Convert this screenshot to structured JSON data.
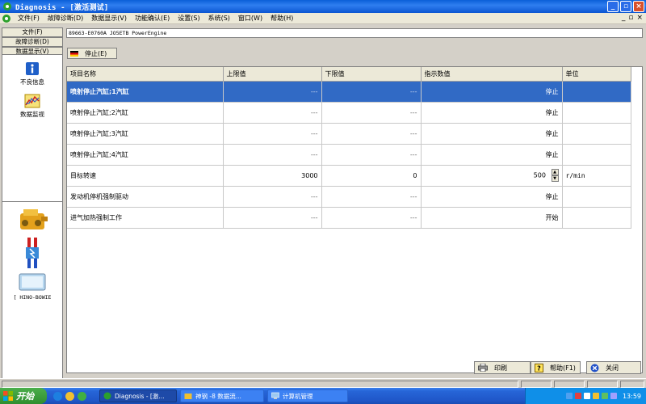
{
  "window": {
    "title": "Diagnosis - [激活测试]"
  },
  "menu": [
    {
      "label": "文件(F)"
    },
    {
      "label": "故障诊断(D)"
    },
    {
      "label": "数据显示(V)"
    },
    {
      "label": "功能确认(E)"
    },
    {
      "label": "设置(S)"
    },
    {
      "label": "系统(S)"
    },
    {
      "label": "窗口(W)"
    },
    {
      "label": "帮助(H)"
    }
  ],
  "left_tabs": [
    {
      "label": "文件(F)"
    },
    {
      "label": "故障诊断(D)"
    },
    {
      "label": "数据显示(V)"
    }
  ],
  "tools": [
    {
      "label": "不良信息",
      "icon": "info-icon"
    },
    {
      "label": "数据监视",
      "icon": "chart-icon"
    }
  ],
  "device": {
    "label": "[ HINO-BOWIE"
  },
  "vin_text": "89663-E0760A JO5ETB PowerEngine",
  "stop_button": {
    "label": "停止(E)"
  },
  "table": {
    "headers": [
      "项目名称",
      "上限值",
      "下限值",
      "指示数值",
      "单位"
    ],
    "rows": [
      {
        "name": "喷射停止汽缸;1汽缸",
        "upper": "---",
        "lower": "---",
        "value": "停止",
        "unit": ""
      },
      {
        "name": "喷射停止汽缸;2汽缸",
        "upper": "---",
        "lower": "---",
        "value": "停止",
        "unit": ""
      },
      {
        "name": "喷射停止汽缸;3汽缸",
        "upper": "---",
        "lower": "---",
        "value": "停止",
        "unit": ""
      },
      {
        "name": "喷射停止汽缸;4汽缸",
        "upper": "---",
        "lower": "---",
        "value": "停止",
        "unit": ""
      },
      {
        "name": "目标转速",
        "upper": "3000",
        "lower": "0",
        "value": "500",
        "unit": "r/min"
      },
      {
        "name": "发动机停机强制驱动",
        "upper": "---",
        "lower": "---",
        "value": "停止",
        "unit": ""
      },
      {
        "name": "进气加热强制工作",
        "upper": "---",
        "lower": "---",
        "value": "开始",
        "unit": ""
      }
    ]
  },
  "bottom_buttons": {
    "print": "印刷",
    "help": "帮助(F1)",
    "close": "关闭"
  },
  "taskbar": {
    "start": "开始",
    "tasks": [
      {
        "label": "Diagnosis - [激..."
      },
      {
        "label": "神钢 -8  数据流..."
      },
      {
        "label": "计算机管理"
      }
    ],
    "clock": "13:59"
  },
  "colors": {
    "selection": "#316ac5",
    "titlebar": "#0a5fd8"
  }
}
